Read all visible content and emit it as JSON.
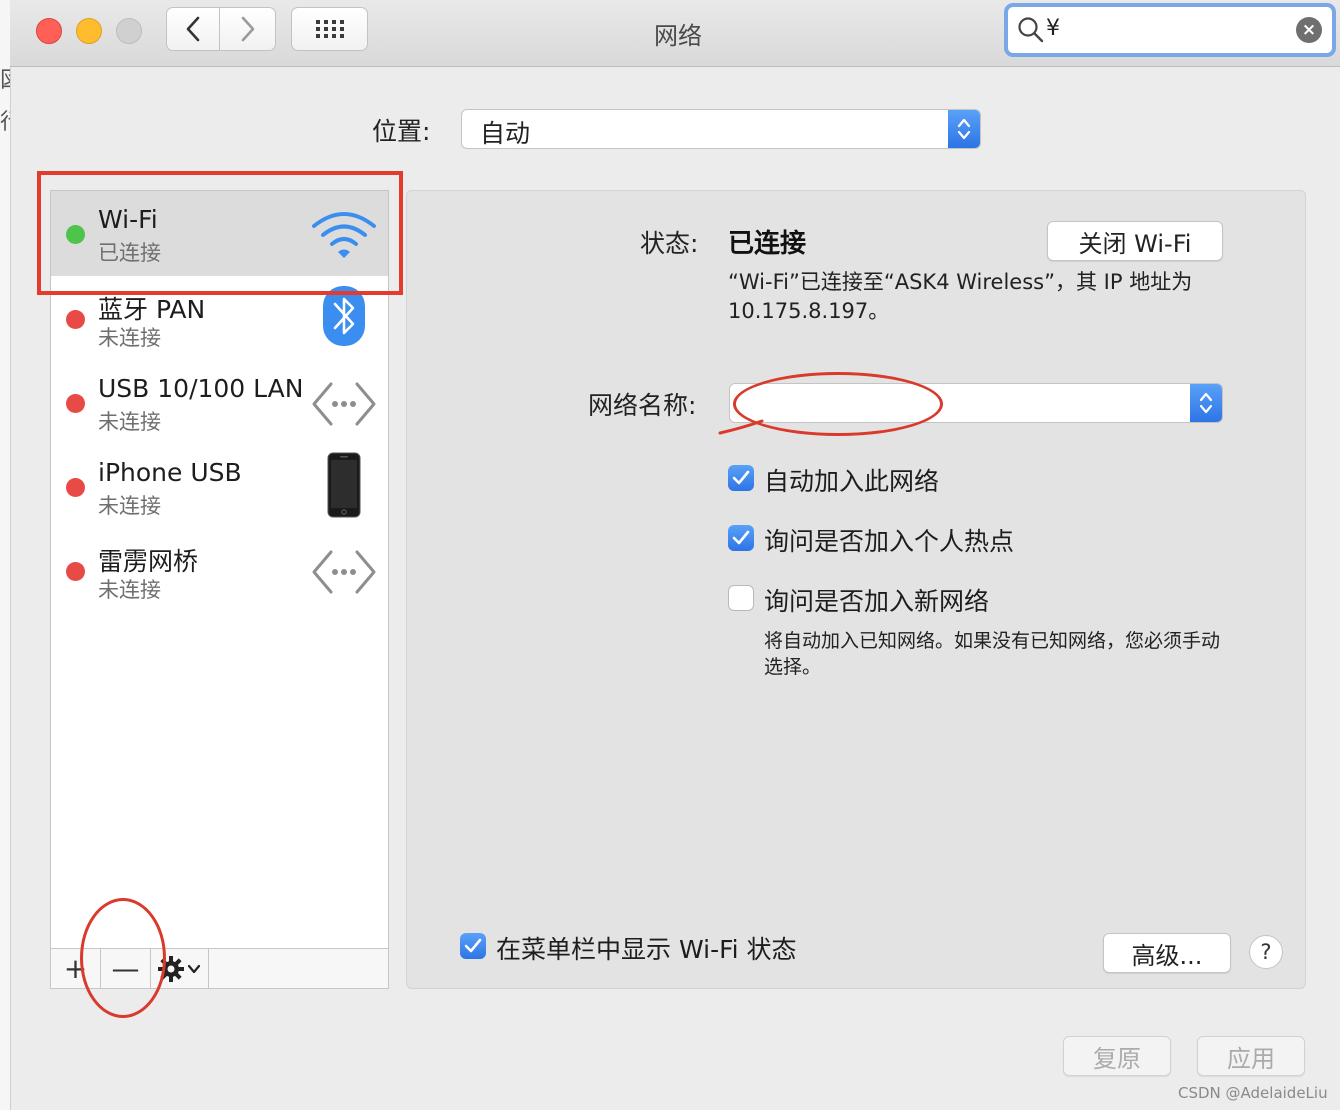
{
  "window": {
    "title": "网络",
    "search_value": "¥"
  },
  "location": {
    "label": "位置:",
    "value": "自动"
  },
  "services": [
    {
      "name": "Wi-Fi",
      "status": "已连接",
      "icon": "wifi-icon",
      "state": "connected"
    },
    {
      "name": "蓝牙 PAN",
      "status": "未连接",
      "icon": "bluetooth-icon",
      "state": "disconnected"
    },
    {
      "name": "USB 10/100 LAN",
      "status": "未连接",
      "icon": "ethernet-icon",
      "state": "disconnected"
    },
    {
      "name": "iPhone USB",
      "status": "未连接",
      "icon": "iphone-icon",
      "state": "disconnected"
    },
    {
      "name": "雷雳网桥",
      "status": "未连接",
      "icon": "ethernet-icon",
      "state": "disconnected"
    }
  ],
  "list_footer": {
    "add": "+",
    "remove": "—"
  },
  "detail": {
    "status_label": "状态:",
    "status_value": "已连接",
    "turn_off_button": "关闭 Wi-Fi",
    "status_description": "“Wi-Fi”已连接至“ASK4 Wireless”，其 IP 地址为 10.175.8.197。",
    "network_name_label": "网络名称:",
    "network_name_value": "",
    "options": [
      {
        "label": "自动加入此网络",
        "checked": true
      },
      {
        "label": "询问是否加入个人热点",
        "checked": true
      },
      {
        "label": "询问是否加入新网络",
        "checked": false
      }
    ],
    "hint": "将自动加入已知网络。如果没有已知网络，您必须手动选择。",
    "show_in_menubar": {
      "label": "在菜单栏中显示 Wi-Fi 状态",
      "checked": true
    },
    "advanced_button": "高级...",
    "help_button": "?"
  },
  "bottom": {
    "revert_button": "复原",
    "apply_button": "应用"
  },
  "watermark": "CSDN @AdelaideLiu",
  "colors": {
    "accent": "#2d74e6",
    "connected": "#4ec44a",
    "disconnected": "#e84b45",
    "annotation": "#e33b2e"
  }
}
